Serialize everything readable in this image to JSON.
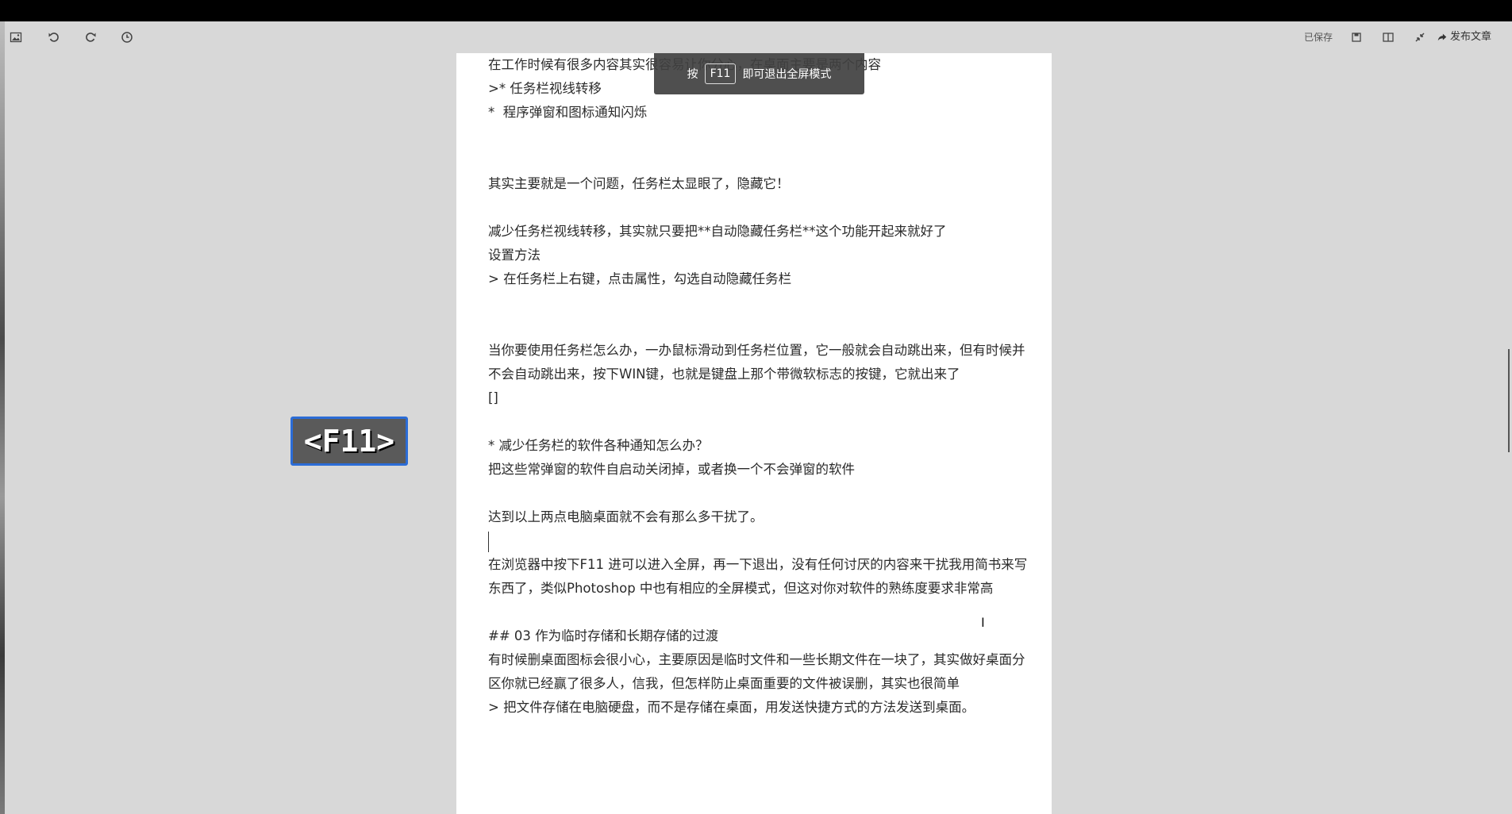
{
  "toolbar": {
    "left_icons": [
      "image-icon",
      "undo-icon",
      "redo-icon",
      "history-icon"
    ],
    "saved_label": "已保存",
    "right_icons": [
      "save-icon",
      "split-view-icon",
      "exit-fullscreen-icon"
    ],
    "publish_label": "发布文章"
  },
  "toast": {
    "prefix": "按",
    "key": "F11",
    "suffix": "即可退出全屏模式"
  },
  "keystroke_overlay": "<F11>",
  "editor": {
    "lines": [
      "在工作时候有很多内容其实很容易让你分心，在桌面主要是两个内容",
      ">* 任务栏视线转移",
      "*  程序弹窗和图标通知闪烁",
      "",
      "",
      "其实主要就是一个问题，任务栏太显眼了，隐藏它！",
      "",
      "减少任务栏视线转移，其实就只要把**自动隐藏任务栏**这个功能开起来就好了",
      "设置方法",
      "> 在任务栏上右键，点击属性，勾选自动隐藏任务栏",
      "",
      "",
      "当你要使用任务栏怎么办，一办鼠标滑动到任务栏位置，它一般就会自动跳出来，但有时候并不会自动跳出来，按下WIN键，也就是键盘上那个带微软标志的按键，它就出来了",
      "[]",
      "",
      "* 减少任务栏的软件各种通知怎么办？",
      "把这些常弹窗的软件自启动关闭掉，或者换一个不会弹窗的软件",
      "",
      "达到以上两点电脑桌面就不会有那么多干扰了。",
      "",
      "在浏览器中按下F11 进可以进入全屏，再一下退出，没有任何讨厌的内容来干扰我用简书来写东西了，类似Photoshop 中也有相应的全屏模式，但这对你对软件的熟练度要求非常高",
      "",
      "## 03 作为临时存储和长期存储的过渡",
      "有时候删桌面图标会很小心，主要原因是临时文件和一些长期文件在一块了，其实做好桌面分区你就已经赢了很多人，信我，但怎样防止桌面重要的文件被误删，其实也很简单",
      "> 把文件存储在电脑硬盘，而不是存储在桌面，用发送快捷方式的方法发送到桌面。"
    ]
  }
}
